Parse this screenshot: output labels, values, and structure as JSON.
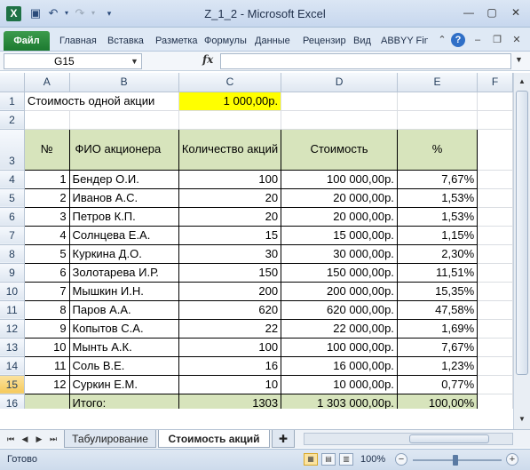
{
  "window": {
    "title": "Z_1_2  -  Microsoft Excel",
    "app_icon": "X"
  },
  "ribbon": {
    "file_label": "Файл",
    "tabs": [
      "Главная",
      "Вставка",
      "Разметка",
      "Формулы",
      "Данные",
      "Рецензир",
      "Вид",
      "ABBYY Fin"
    ]
  },
  "formula_bar": {
    "name_box": "G15",
    "fx_label": "fx",
    "formula": ""
  },
  "columns": [
    "A",
    "B",
    "C",
    "D",
    "E",
    "F"
  ],
  "sheet": {
    "a1": "Стоимость одной акции",
    "c1": "1 000,00р.",
    "headers": {
      "num": "№",
      "name": "ФИО акционера",
      "qty": "Количество акций",
      "cost": "Стоимость",
      "pct": "%"
    },
    "rows": [
      {
        "row": "4",
        "num": "1",
        "name": "Бендер О.И.",
        "qty": "100",
        "cost": "100 000,00р.",
        "pct": "7,67%"
      },
      {
        "row": "5",
        "num": "2",
        "name": "Иванов А.С.",
        "qty": "20",
        "cost": "20 000,00р.",
        "pct": "1,53%"
      },
      {
        "row": "6",
        "num": "3",
        "name": "Петров К.П.",
        "qty": "20",
        "cost": "20 000,00р.",
        "pct": "1,53%"
      },
      {
        "row": "7",
        "num": "4",
        "name": "Солнцева Е.А.",
        "qty": "15",
        "cost": "15 000,00р.",
        "pct": "1,15%"
      },
      {
        "row": "8",
        "num": "5",
        "name": "Куркина Д.О.",
        "qty": "30",
        "cost": "30 000,00р.",
        "pct": "2,30%"
      },
      {
        "row": "9",
        "num": "6",
        "name": "Золотарева И.Р.",
        "qty": "150",
        "cost": "150 000,00р.",
        "pct": "11,51%"
      },
      {
        "row": "10",
        "num": "7",
        "name": "Мышкин И.Н.",
        "qty": "200",
        "cost": "200 000,00р.",
        "pct": "15,35%"
      },
      {
        "row": "11",
        "num": "8",
        "name": "Паров А.А.",
        "qty": "620",
        "cost": "620 000,00р.",
        "pct": "47,58%"
      },
      {
        "row": "12",
        "num": "9",
        "name": "Копытов С.А.",
        "qty": "22",
        "cost": "22 000,00р.",
        "pct": "1,69%"
      },
      {
        "row": "13",
        "num": "10",
        "name": "Мынть А.К.",
        "qty": "100",
        "cost": "100 000,00р.",
        "pct": "7,67%"
      },
      {
        "row": "14",
        "num": "11",
        "name": "Соль В.Е.",
        "qty": "16",
        "cost": "16 000,00р.",
        "pct": "1,23%"
      },
      {
        "row": "15",
        "num": "12",
        "name": "Суркин Е.М.",
        "qty": "10",
        "cost": "10 000,00р.",
        "pct": "0,77%"
      }
    ],
    "total": {
      "label": "Итого:",
      "qty": "1303",
      "cost": "1 303 000,00р.",
      "pct": "100,00%"
    }
  },
  "sheet_tabs": [
    "Табулирование",
    "Стоимость акций"
  ],
  "status": {
    "ready": "Готово",
    "zoom": "100%"
  },
  "colors": {
    "header_fill": "#d7e4bc",
    "price_fill": "#ffff00",
    "file_tab": "#1c7a30"
  }
}
